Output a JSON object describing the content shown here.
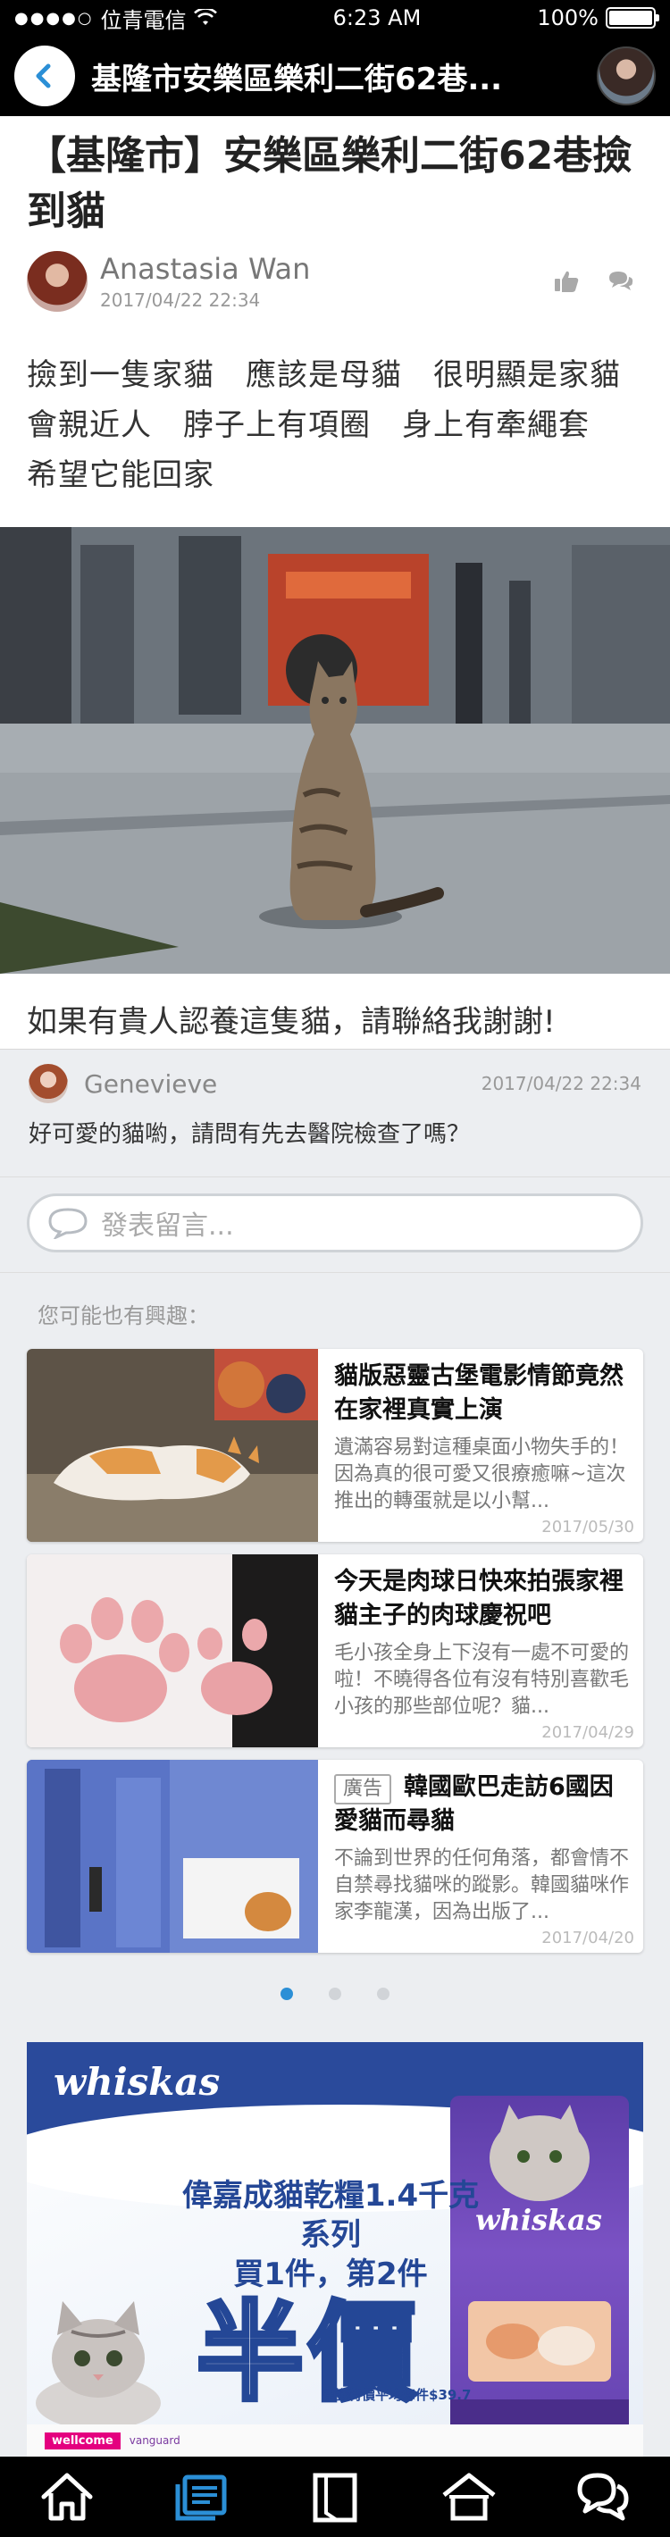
{
  "status_bar": {
    "carrier": "位青電信",
    "time": "6:23 AM",
    "battery": "100%",
    "battery_level": 1.0
  },
  "nav": {
    "title": "基隆市安樂區樂利二街62巷..."
  },
  "post": {
    "title": "【基隆市】安樂區樂利二街62巷撿到貓",
    "author": "Anastasia Wan",
    "date": "2017/04/22 22:34",
    "body": "撿到一隻家貓　應該是母貓　很明顯是家貓會親近人　脖子上有項圈　身上有牽繩套　希望它能回家",
    "caption": "如果有貴人認養這隻貓，請聯絡我謝謝!"
  },
  "comment": {
    "name": "Genevieve",
    "date": "2017/04/22 22:34",
    "text": "好可愛的貓喲，請問有先去醫院檢查了嗎？",
    "input_placeholder": "發表留言..."
  },
  "related": {
    "heading": "您可能也有興趣：",
    "items": [
      {
        "title": "貓版惡靈古堡電影情節竟然在家裡真實上演",
        "excerpt": "遺滿容易對這種桌面小物失手的！因為真的很可愛又很療癒嘛~這次推出的轉蛋就是以小幫...",
        "date": "2017/05/30",
        "ad": ""
      },
      {
        "title": "今天是肉球日快來拍張家裡貓主子的肉球慶祝吧",
        "excerpt": "毛小孩全身上下沒有一處不可愛的啦！不曉得各位有沒有特別喜歡毛小孩的那些部位呢？貓...",
        "date": "2017/04/29",
        "ad": ""
      },
      {
        "title": "韓國歐巴走訪6國因愛貓而尋貓",
        "excerpt": "不論到世界的任何角落，都會情不自禁尋找貓咪的蹤影。韓國貓咪作家李龍漢，因為出版了...",
        "date": "2017/04/20",
        "ad": "廣告"
      }
    ]
  },
  "ad": {
    "brand": "whiskas",
    "headline_1": "偉嘉成貓乾糧1.4千克系列",
    "headline_2": "買1件，第2件",
    "big_text": "半價",
    "sub_text": "建議特價平均每件$39.7",
    "pack_brand": "whiskas",
    "store": "wellcome",
    "vendor": "vanguard"
  },
  "tabs": [
    {
      "icon": "home-icon"
    },
    {
      "icon": "posts-icon",
      "active": true
    },
    {
      "icon": "book-icon"
    },
    {
      "icon": "shelter-icon"
    },
    {
      "icon": "chat-icon"
    }
  ],
  "colors": {
    "accent": "#2b8fd6",
    "bar": "#000000",
    "background": "#eceef1"
  }
}
